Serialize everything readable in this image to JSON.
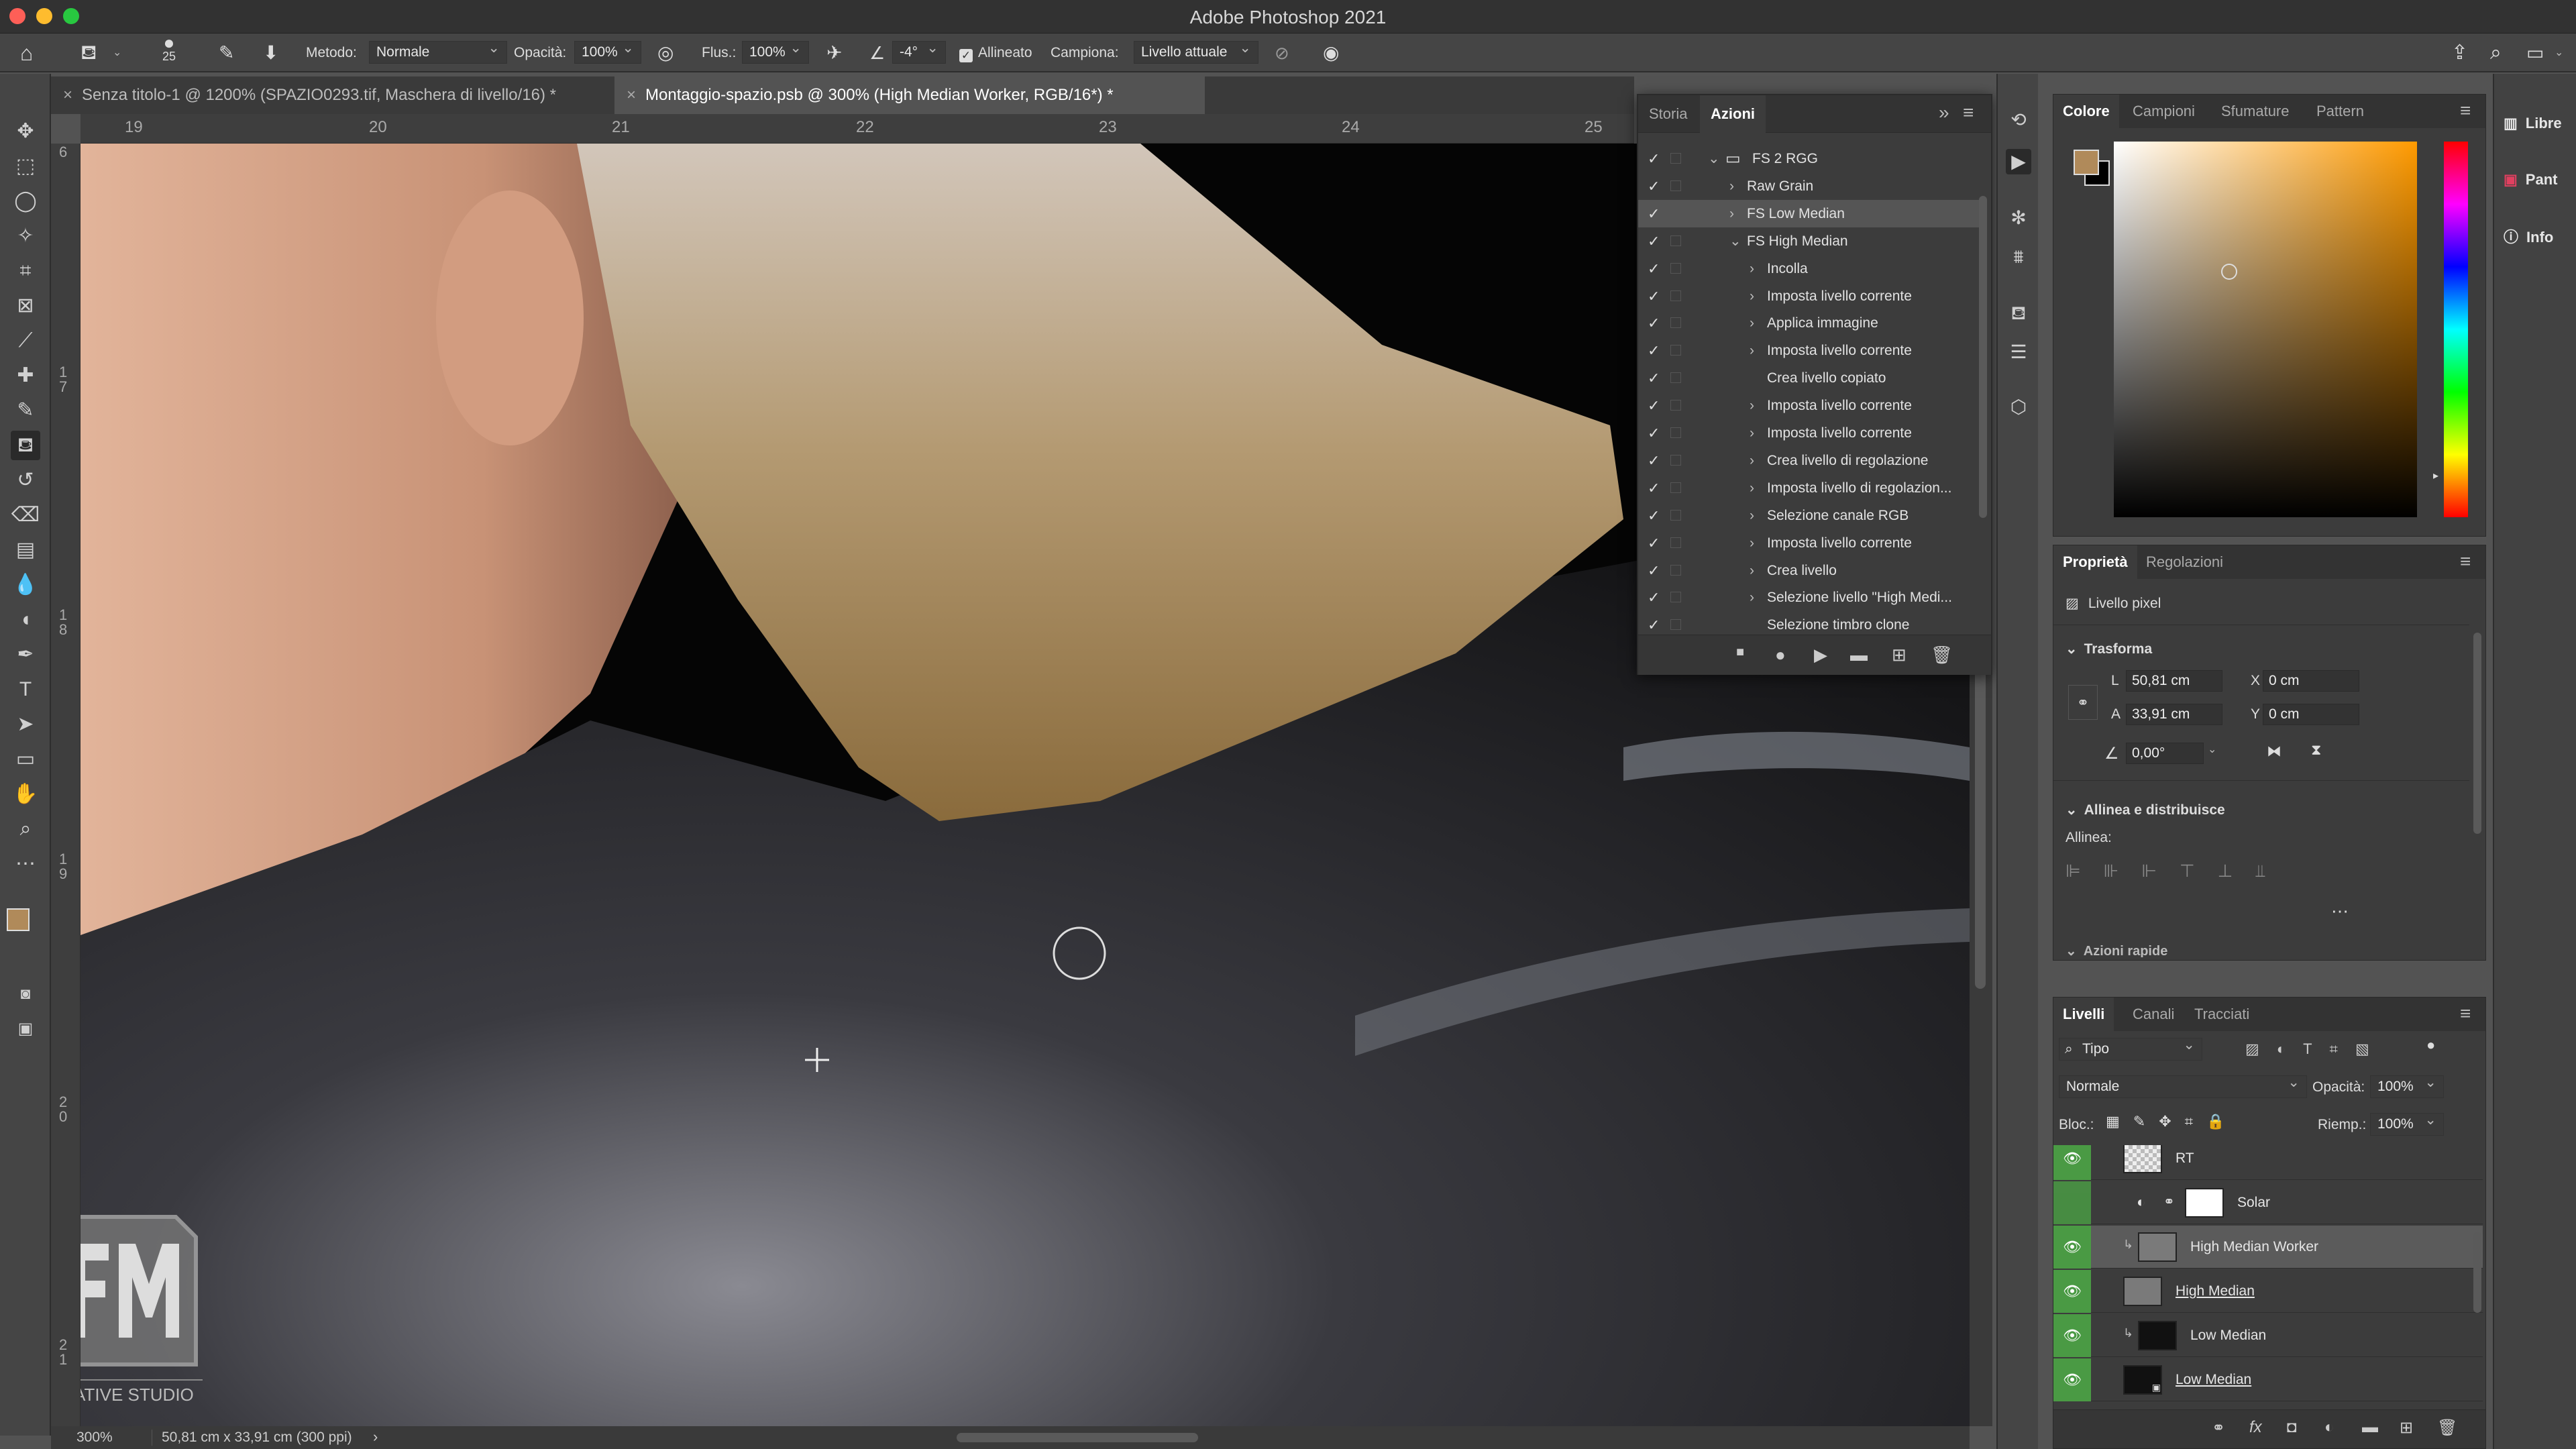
{
  "window": {
    "title": "Adobe Photoshop 2021"
  },
  "options_bar": {
    "brush_size": "25",
    "method_label": "Metodo:",
    "method_value": "Normale",
    "opacity_label": "Opacità:",
    "opacity_value": "100%",
    "flow_label": "Flus.:",
    "flow_value": "100%",
    "angle_value": "-4°",
    "aligned_label": "Allineato",
    "sample_label": "Campiona:",
    "sample_value": "Livello attuale"
  },
  "doc_tabs": [
    {
      "label": "Senza titolo-1 @ 1200% (SPAZIO0293.tif, Maschera di livello/16) *"
    },
    {
      "label": "Montaggio-spazio.psb @ 300% (High Median Worker, RGB/16*) *"
    }
  ],
  "ruler": {
    "h_ticks": [
      "19",
      "20",
      "21",
      "22",
      "23",
      "24",
      "25"
    ],
    "v_ticks": [
      "6",
      "1\n7",
      "1\n8",
      "1\n9",
      "2\n0",
      "2\n1"
    ]
  },
  "status": {
    "zoom": "300%",
    "doc_info": "50,81 cm x 33,91 cm (300 ppi)"
  },
  "watermark": {
    "text": "CREATIVE STUDIO"
  },
  "actions_panel": {
    "tabs": [
      "Storia",
      "Azioni"
    ],
    "active_tab": "Azioni",
    "rows": [
      {
        "label": "FS 2 RGG",
        "indent": 0,
        "type": "set",
        "expanded": true
      },
      {
        "label": "Raw Grain",
        "indent": 1,
        "type": "action",
        "expanded": false
      },
      {
        "label": "FS Low Median",
        "indent": 1,
        "type": "action",
        "expanded": false,
        "selected": true
      },
      {
        "label": "FS High Median",
        "indent": 1,
        "type": "action",
        "expanded": true
      },
      {
        "label": "Incolla",
        "indent": 2,
        "type": "step",
        "expandable": true
      },
      {
        "label": "Imposta livello corrente",
        "indent": 2,
        "type": "step",
        "expandable": true
      },
      {
        "label": "Applica immagine",
        "indent": 2,
        "type": "step",
        "expandable": true
      },
      {
        "label": "Imposta livello corrente",
        "indent": 2,
        "type": "step",
        "expandable": true
      },
      {
        "label": "Crea livello copiato",
        "indent": 2,
        "type": "step",
        "expandable": false
      },
      {
        "label": "Imposta livello corrente",
        "indent": 2,
        "type": "step",
        "expandable": true
      },
      {
        "label": "Imposta livello corrente",
        "indent": 2,
        "type": "step",
        "expandable": true
      },
      {
        "label": "Crea livello di regolazione",
        "indent": 2,
        "type": "step",
        "expandable": true
      },
      {
        "label": "Imposta livello di regolazion...",
        "indent": 2,
        "type": "step",
        "expandable": true
      },
      {
        "label": "Selezione canale RGB",
        "indent": 2,
        "type": "step",
        "expandable": true
      },
      {
        "label": "Imposta livello corrente",
        "indent": 2,
        "type": "step",
        "expandable": true
      },
      {
        "label": "Crea livello",
        "indent": 2,
        "type": "step",
        "expandable": true
      },
      {
        "label": "Selezione livello \"High Medi...",
        "indent": 2,
        "type": "step",
        "expandable": true
      },
      {
        "label": "Selezione timbro clone",
        "indent": 2,
        "type": "step",
        "expandable": false
      }
    ]
  },
  "color_panel": {
    "tabs": [
      "Colore",
      "Campioni",
      "Sfumature",
      "Pattern"
    ],
    "active_tab": "Colore",
    "foreground": "#b08a5a",
    "background": "#000000",
    "hue_color": "#ff9a00"
  },
  "libraries": {
    "items": [
      "Libre",
      "Pant",
      "Info"
    ]
  },
  "properties_panel": {
    "tabs": [
      "Proprietà",
      "Regolazioni"
    ],
    "active_tab": "Proprietà",
    "kind": "Livello pixel",
    "transform_label": "Trasforma",
    "w_label": "L",
    "w_value": "50,81 cm",
    "h_label": "A",
    "h_value": "33,91 cm",
    "x_label": "X",
    "x_value": "0 cm",
    "y_label": "Y",
    "y_value": "0 cm",
    "angle_value": "0,00°",
    "align_label": "Allinea e distribuisce",
    "align_sub": "Allinea:",
    "quick_actions": "Azioni rapide"
  },
  "layers_panel": {
    "tabs": [
      "Livelli",
      "Canali",
      "Tracciati"
    ],
    "active_tab": "Livelli",
    "filter_value": "Tipo",
    "blend_value": "Normale",
    "opacity_label": "Opacità:",
    "opacity_value": "100%",
    "lock_label": "Bloc.:",
    "fill_label": "Riemp.:",
    "fill_value": "100%",
    "layers": [
      {
        "name": "RT",
        "visible": true,
        "thumb": "checker",
        "underline": false
      },
      {
        "name": "Solar",
        "visible": false,
        "thumb": "adjust",
        "underline": false
      },
      {
        "name": "High Median Worker",
        "visible": true,
        "thumb": "gray",
        "selected": true,
        "clipped": true,
        "underline": false
      },
      {
        "name": "High Median",
        "visible": true,
        "thumb": "gray",
        "underline": true
      },
      {
        "name": "Low Median",
        "visible": true,
        "thumb": "dark",
        "clipped": true,
        "underline": false
      },
      {
        "name": "Low Median",
        "visible": true,
        "thumb": "dark-smart",
        "underline": true
      }
    ]
  }
}
